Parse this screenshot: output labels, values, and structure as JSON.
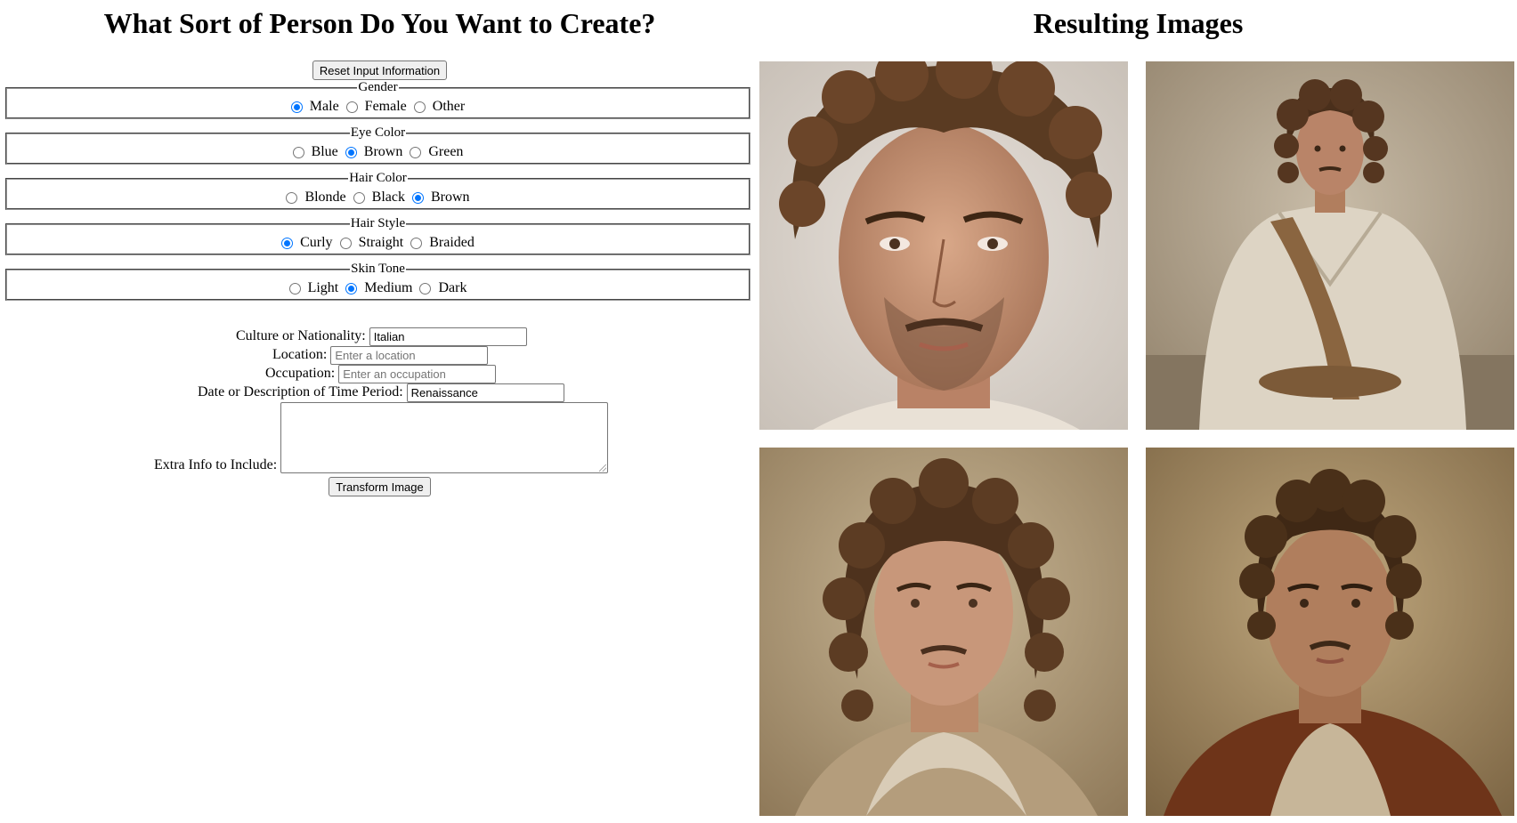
{
  "form": {
    "title": "What Sort of Person Do You Want to Create?",
    "reset_label": "Reset Input Information",
    "groups": [
      {
        "legend": "Gender",
        "options": [
          "Male",
          "Female",
          "Other"
        ],
        "selected": "Male"
      },
      {
        "legend": "Eye Color",
        "options": [
          "Blue",
          "Brown",
          "Green"
        ],
        "selected": "Brown"
      },
      {
        "legend": "Hair Color",
        "options": [
          "Blonde",
          "Black",
          "Brown"
        ],
        "selected": "Brown"
      },
      {
        "legend": "Hair Style",
        "options": [
          "Curly",
          "Straight",
          "Braided"
        ],
        "selected": "Curly"
      },
      {
        "legend": "Skin Tone",
        "options": [
          "Light",
          "Medium",
          "Dark"
        ],
        "selected": "Medium"
      }
    ],
    "culture": {
      "label": "Culture or Nationality:",
      "value": "Italian"
    },
    "location": {
      "label": "Location:",
      "placeholder": "Enter a location"
    },
    "occupation": {
      "label": "Occupation:",
      "placeholder": "Enter an occupation"
    },
    "period": {
      "label": "Date or Description of Time Period:",
      "value": "Renaissance"
    },
    "extra": {
      "label": "Extra Info to Include:",
      "value": ""
    },
    "transform_label": "Transform Image"
  },
  "results": {
    "title": "Resulting Images",
    "images": [
      {
        "subject": "close-up portrait of curly-haired man",
        "background": "#cfc8bf"
      },
      {
        "subject": "seated man in linen tunic",
        "background": "#a89a85"
      },
      {
        "subject": "man with curly hair and scarf",
        "background": "#a38f70"
      },
      {
        "subject": "man in brown robe",
        "background": "#8e7750"
      }
    ]
  }
}
